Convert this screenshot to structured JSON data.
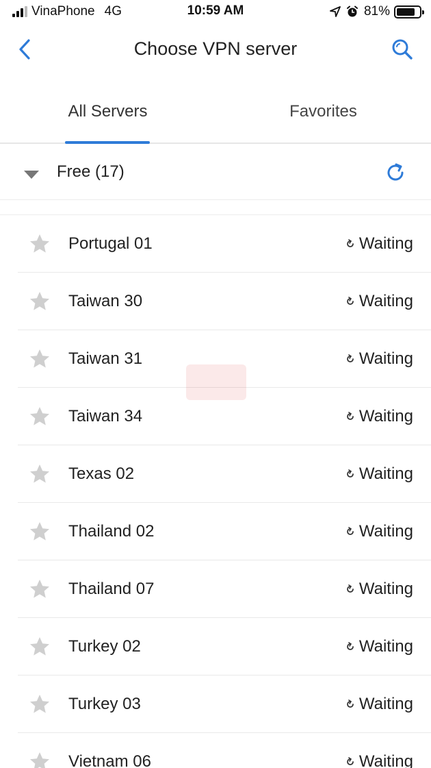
{
  "status_bar": {
    "carrier": "VinaPhone",
    "network": "4G",
    "time": "10:59 AM",
    "battery": "81%",
    "battery_level": 0.81
  },
  "nav": {
    "title": "Choose VPN server"
  },
  "tabs": [
    {
      "label": "All Servers",
      "active": true
    },
    {
      "label": "Favorites",
      "active": false
    }
  ],
  "group": {
    "title": "Free (17)"
  },
  "servers": [
    {
      "name": "Portugal 01",
      "status": "Waiting"
    },
    {
      "name": "Taiwan 30",
      "status": "Waiting"
    },
    {
      "name": "Taiwan 31",
      "status": "Waiting"
    },
    {
      "name": "Taiwan 34",
      "status": "Waiting"
    },
    {
      "name": "Texas 02",
      "status": "Waiting"
    },
    {
      "name": "Thailand 02",
      "status": "Waiting"
    },
    {
      "name": "Thailand 07",
      "status": "Waiting"
    },
    {
      "name": "Turkey 02",
      "status": "Waiting"
    },
    {
      "name": "Turkey 03",
      "status": "Waiting"
    },
    {
      "name": "Vietnam 06",
      "status": "Waiting"
    }
  ],
  "colors": {
    "accent": "#2e7bd8",
    "star_inactive": "#cfcfcf",
    "divider": "#e9e9e9"
  },
  "icons": {
    "back": "chevron-left-icon",
    "search": "search-icon",
    "collapse": "triangle-down-icon",
    "refresh": "refresh-icon",
    "favorite": "star-icon",
    "status": "spinner-icon"
  }
}
